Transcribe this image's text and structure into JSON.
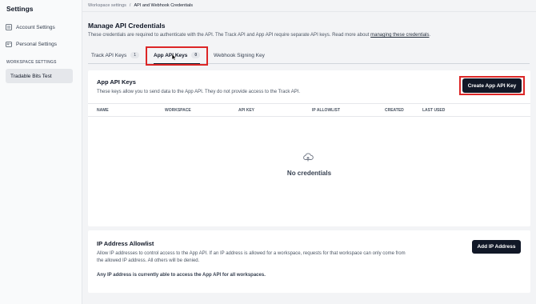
{
  "sidebar": {
    "title": "Settings",
    "items": [
      {
        "label": "Account Settings",
        "icon": "account-icon"
      },
      {
        "label": "Personal Settings",
        "icon": "person-icon"
      }
    ],
    "section_label": "WORKSPACE SETTINGS",
    "workspace": "Tradable Bits Test"
  },
  "breadcrumb": {
    "parent": "Workspace settings",
    "separator": "/",
    "current": "API and Webhook Credentials"
  },
  "page": {
    "title": "Manage API Credentials",
    "subtitle": "These credentials are required to authenticate with the API. The Track API and App API require separate API keys. Read more about",
    "subtitle_link": "managing these credentials",
    "subtitle_end": "."
  },
  "tabs": [
    {
      "label": "Track API Keys",
      "count": "1"
    },
    {
      "label": "App API Keys",
      "count": "0"
    },
    {
      "label": "Webhook Signing Key",
      "count": ""
    }
  ],
  "app_keys": {
    "title": "App API Keys",
    "subtitle": "These keys allow you to send data to the App API. They do not provide access to the Track API.",
    "create_button": "Create App API Key",
    "columns": [
      "NAME",
      "WORKSPACE",
      "API KEY",
      "IP ALLOWLIST",
      "CREATED",
      "LAST USED"
    ],
    "empty_text": "No credentials"
  },
  "allowlist": {
    "title": "IP Address Allowlist",
    "subtitle_line1": "Allow IP addresses to control access to the App API. If an IP address is allowed for a workspace, requests for that workspace can only come from",
    "subtitle_line2": "the allowed IP address. All others will be denied.",
    "note": "Any IP address is currently able to access the App API for all workspaces.",
    "add_button": "Add IP Address"
  },
  "colors": {
    "accent": "#111827",
    "highlight": "#dc2626"
  }
}
